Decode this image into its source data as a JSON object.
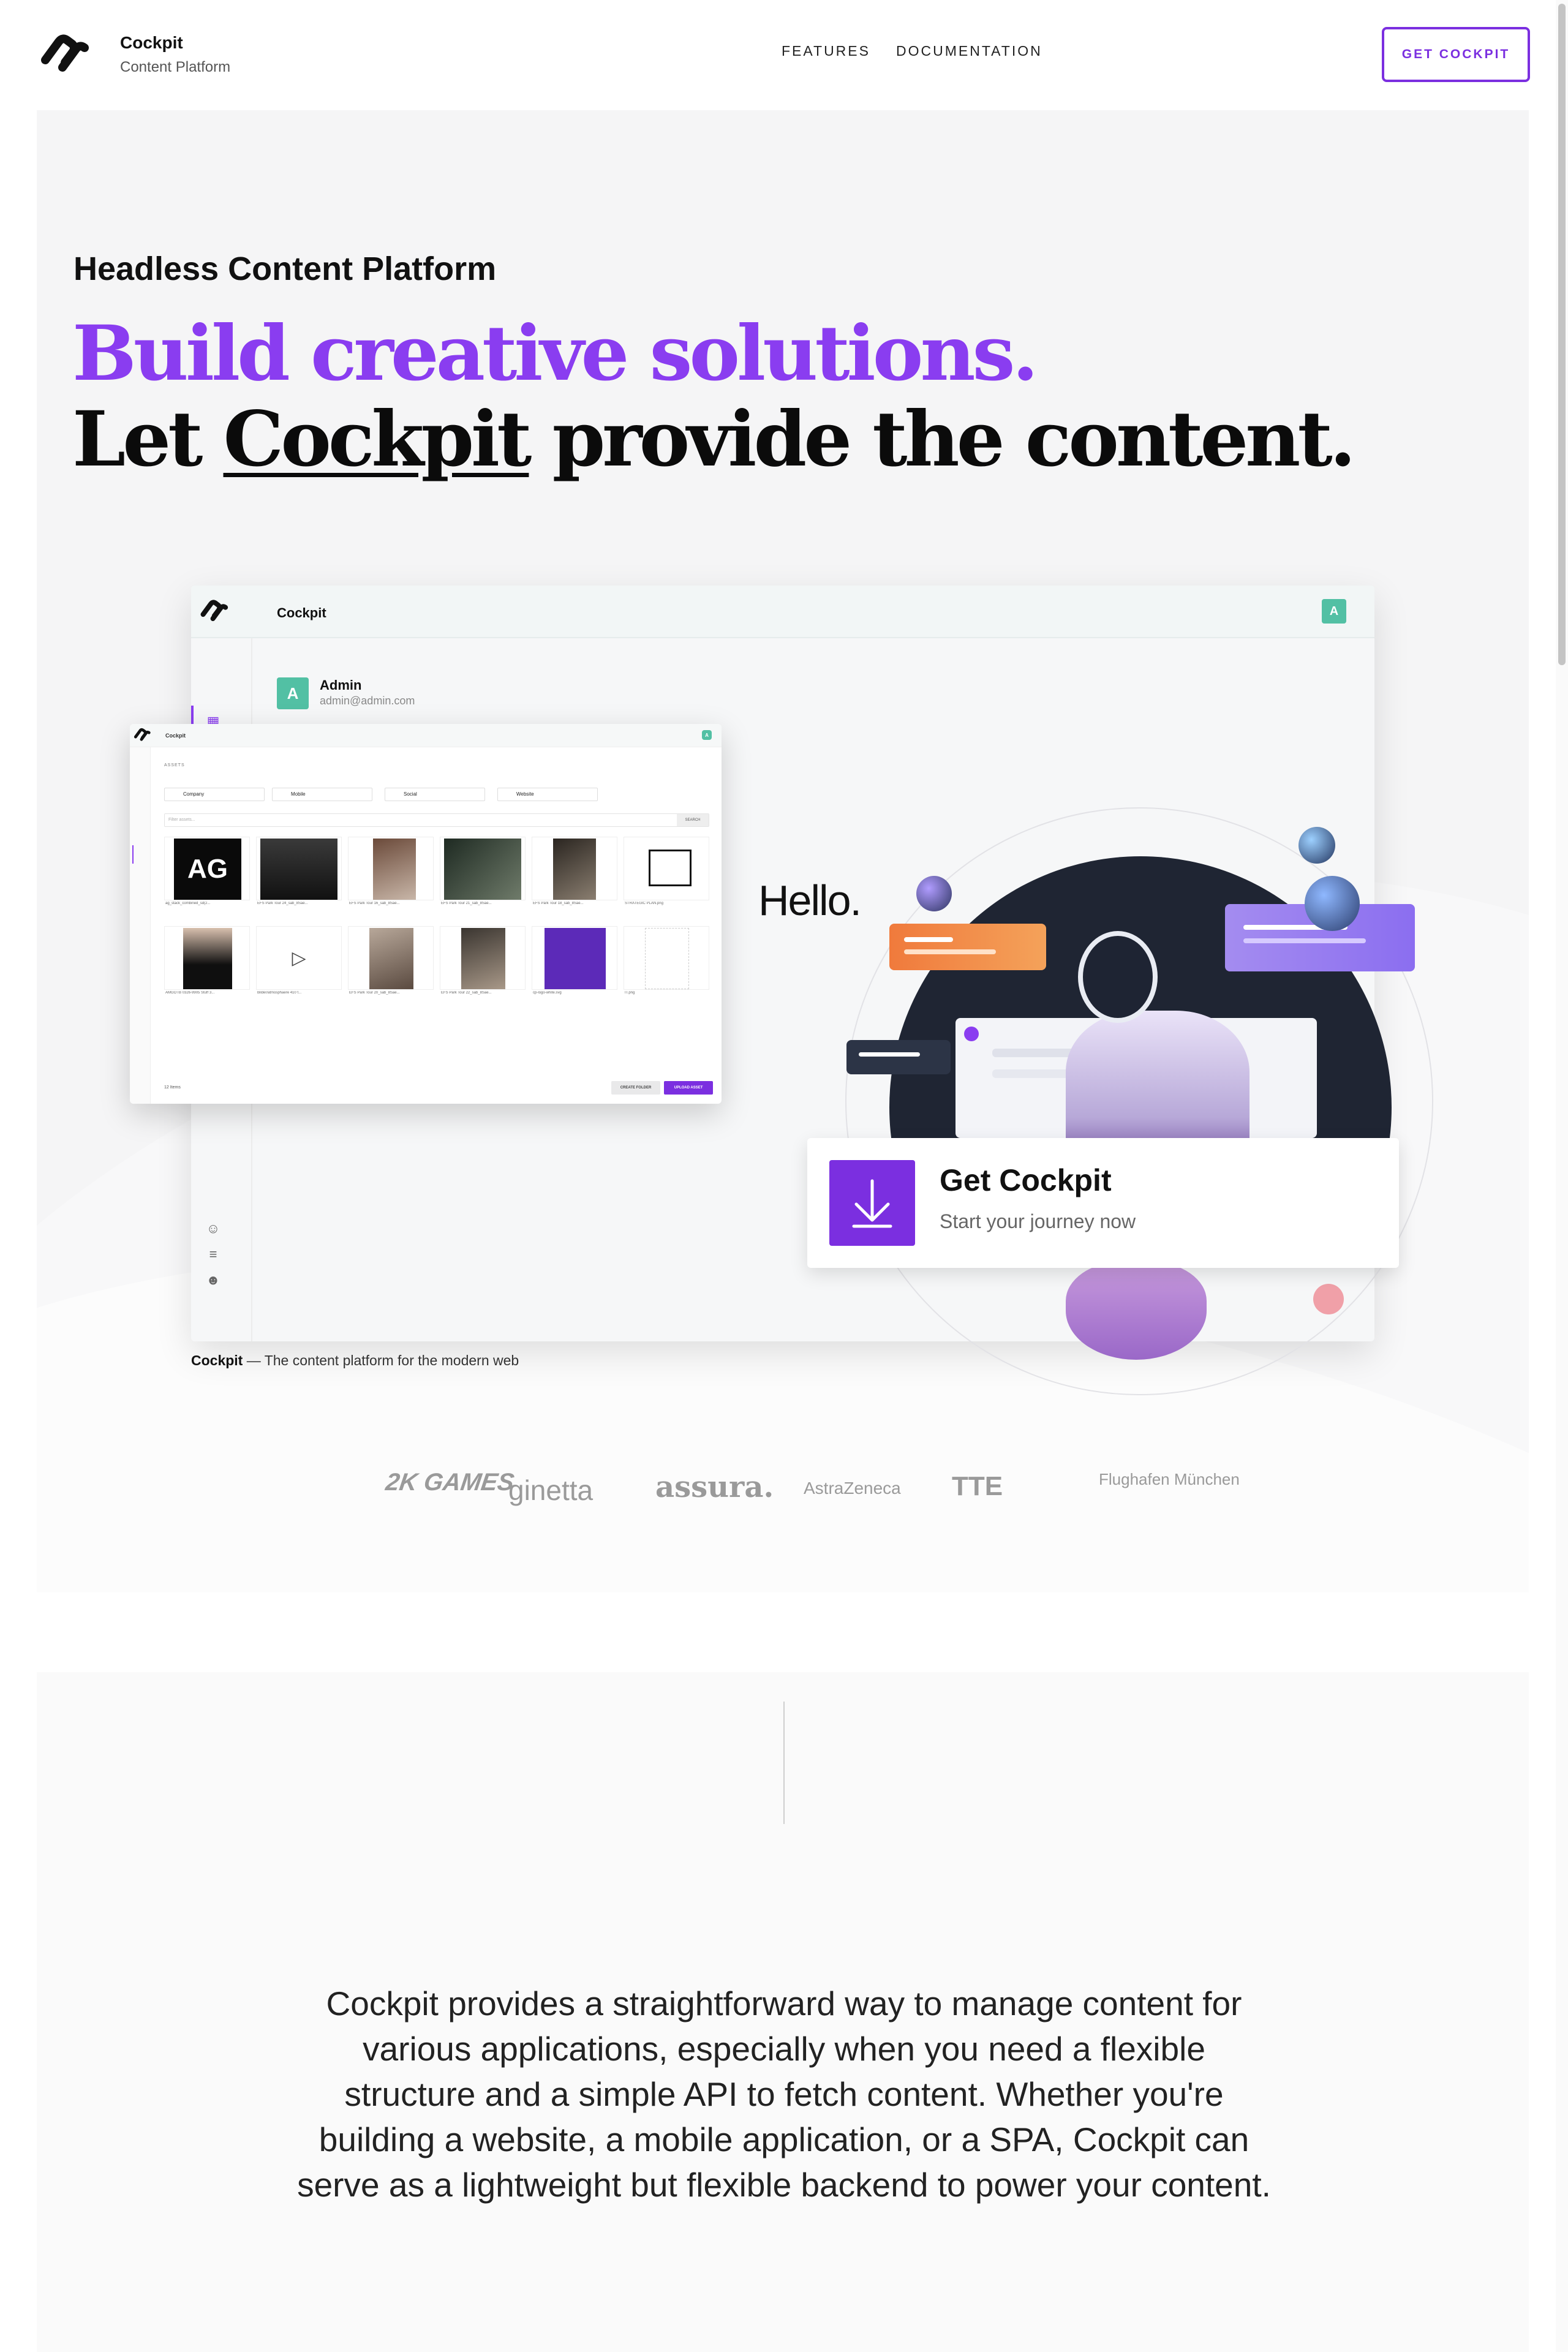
{
  "nav": {
    "brand_name": "Cockpit",
    "brand_sub": "Content Platform",
    "links": [
      "FEATURES",
      "DOCUMENTATION"
    ],
    "cta": "GET COCKPIT"
  },
  "hero": {
    "kicker": "Headless Content Platform",
    "headline_line1": "Build creative solutions.",
    "headline_line2_pre": "Let ",
    "headline_line2_link": "Cockpit",
    "headline_line2_post": " provide the content.",
    "caption_bold": "Cockpit",
    "caption_rest": " — The content platform for the modern web"
  },
  "app": {
    "title": "Cockpit",
    "avatar_letter": "A",
    "user_name": "Admin",
    "user_email": "admin@admin.com"
  },
  "assets_window": {
    "title": "Cockpit",
    "section_label": "ASSETS",
    "folders": [
      "Company",
      "Mobile",
      "Social",
      "Website"
    ],
    "search_placeholder": "Filter assets...",
    "search_button": "SEARCH",
    "tiles": [
      {
        "caption": "ag_stack_combined_sd(2..."
      },
      {
        "caption": "EFS Park Tour 24_sab_8Sae..."
      },
      {
        "caption": "EFS Park Tour 16_sab_8Sae..."
      },
      {
        "caption": "EFS Park Tour 21_sab_8Sae..."
      },
      {
        "caption": "EFS Park Tour 18_sab_8Sae..."
      },
      {
        "caption": "STRATEGIC PLAN.png"
      },
      {
        "caption": "AMGOTB 0326-9905 Stuff 3..."
      },
      {
        "caption": "Bilder/atmosphaere 410 f..."
      },
      {
        "caption": "EFS Park Tour 20_sab_8Sae..."
      },
      {
        "caption": "EFS Park Tour 22_sab_8Sae..."
      },
      {
        "caption": "cp-logo-white.svg"
      },
      {
        "caption": "IT.png"
      }
    ],
    "items_count": "12 Items",
    "create_folder": "CREATE FOLDER",
    "upload": "UPLOAD ASSET"
  },
  "illustration": {
    "hello": "Hello."
  },
  "get_card": {
    "title": "Get Cockpit",
    "subtitle": "Start your journey now"
  },
  "logos": [
    "2K GAMES",
    "ginetta",
    "assura.",
    "AstraZeneca",
    "TTE",
    "Flughafen München"
  ],
  "intro": {
    "text": "Cockpit provides a straightforward way to manage content for various applications, especially when you need a flexible structure and a simple API to fetch content. Whether you're building a website, a mobile application, or a SPA, Cockpit can serve as a lightweight but flexible backend to power your content."
  },
  "colors": {
    "accent": "#8a3df0",
    "button_purple": "#7b2fe0",
    "avatar_green": "#52c0a4"
  }
}
